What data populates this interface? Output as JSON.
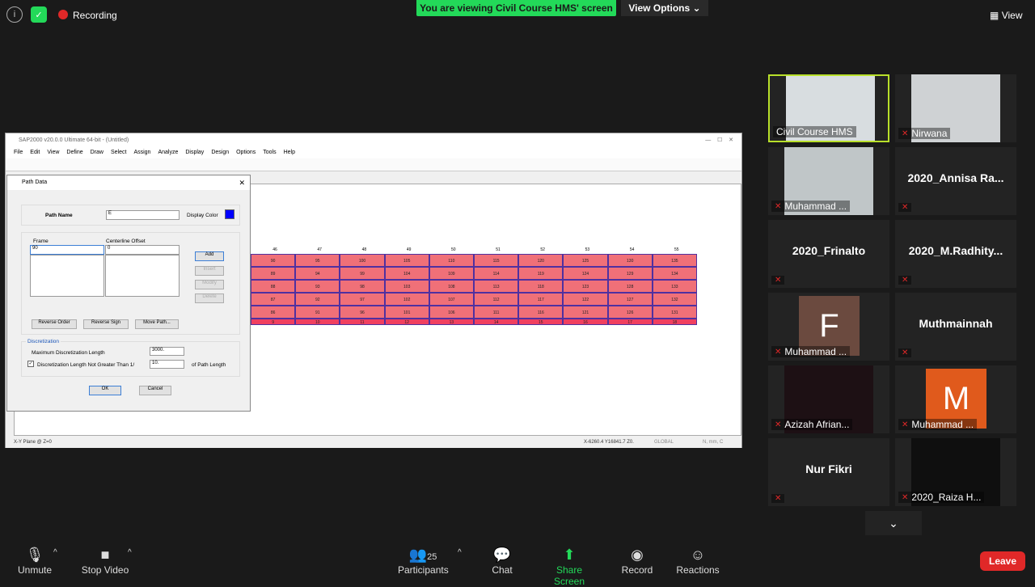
{
  "top": {
    "recording": "Recording",
    "viewing": "You are viewing Civil Course HMS' screen",
    "view_options": "View Options",
    "view": "View"
  },
  "sap": {
    "title": "SAP2000 v20.0.0 Ultimate 64-bit - (Untitled)",
    "menu": [
      "File",
      "Edit",
      "View",
      "Define",
      "Draw",
      "Select",
      "Assign",
      "Analyze",
      "Display",
      "Design",
      "Options",
      "Tools",
      "Help"
    ],
    "status_left": "X-Y Plane @ Z=0",
    "status_coords": "X-6260.4  Y16841.7  Z0.",
    "status_global": "GLOBAL",
    "status_units": "N, mm, C",
    "top_labels": [
      "46",
      "47",
      "48",
      "49",
      "50",
      "51",
      "52",
      "53",
      "54",
      "55"
    ],
    "rows": [
      [
        "90",
        "95",
        "100",
        "105",
        "110",
        "115",
        "120",
        "125",
        "130",
        "135"
      ],
      [
        "89",
        "94",
        "99",
        "104",
        "109",
        "114",
        "119",
        "124",
        "129",
        "134"
      ],
      [
        "88",
        "93",
        "98",
        "103",
        "108",
        "113",
        "118",
        "123",
        "128",
        "133"
      ],
      [
        "87",
        "92",
        "97",
        "102",
        "107",
        "112",
        "117",
        "122",
        "127",
        "132"
      ],
      [
        "86",
        "91",
        "96",
        "101",
        "106",
        "111",
        "116",
        "121",
        "126",
        "131"
      ],
      [
        "9",
        "10",
        "11",
        "12",
        "13",
        "14",
        "15",
        "16",
        "17",
        "18"
      ]
    ]
  },
  "dialog": {
    "title": "Path Data",
    "path_name_label": "Path Name",
    "path_name_value": "E",
    "display_color_label": "Display Color",
    "display_color": "#0000ff",
    "frame_label": "Frame",
    "frame_value": "90",
    "offset_label": "Centerline Offset",
    "offset_value": "0",
    "add": "Add",
    "insert": "Insert",
    "modify": "Modify",
    "delete": "Delete",
    "reverse_order": "Reverse Order",
    "reverse_sign": "Reverse Sign",
    "move_path": "Move Path...",
    "discretization": "Discretization",
    "max_disc_label": "Maximum Discretization Length",
    "max_disc_value": "3000.",
    "disc_not_greater_label": "Discretization Length Not Greater Than  1/",
    "disc_not_greater_value": "10.",
    "of_path_length": "of Path Length",
    "ok": "OK",
    "cancel": "Cancel"
  },
  "participants": [
    {
      "name": "Civil Course HMS",
      "video": true,
      "active": true
    },
    {
      "name": "Nirwana",
      "video": true
    },
    {
      "name": "Muhammad ...",
      "video": true
    },
    {
      "name": "2020_Annisa Ra...",
      "big": true
    },
    {
      "name": "2020_Frinalto",
      "big": true
    },
    {
      "name": "2020_M.Radhity...",
      "big": true
    },
    {
      "name": "Muhammad ...",
      "letter": "F"
    },
    {
      "name": "Muthmainnah",
      "big": true
    },
    {
      "name": "Azizah Afrian...",
      "video": true
    },
    {
      "name": "Muhammad ...",
      "letter": "M"
    },
    {
      "name": "Nur Fikri",
      "big": true
    },
    {
      "name": "2020_Raiza H...",
      "video": true
    }
  ],
  "bottom": {
    "unmute": "Unmute",
    "stop_video": "Stop Video",
    "participants": "Participants",
    "participants_count": "25",
    "chat": "Chat",
    "share": "Share Screen",
    "record": "Record",
    "reactions": "Reactions",
    "leave": "Leave"
  }
}
